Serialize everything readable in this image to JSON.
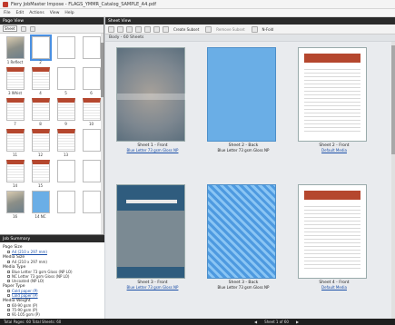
{
  "window": {
    "title": "Fiery JobMaster Impose - FLAGS_YMMR_Catalog_SAMPLE_A4.pdf"
  },
  "menu": [
    "File",
    "Edit",
    "Actions",
    "View",
    "Help"
  ],
  "page_view": {
    "header": "Page View",
    "mode": "Sheet",
    "thumbnails": [
      {
        "label": "1 Reflect",
        "kind": "photo"
      },
      {
        "label": "2",
        "kind": "white",
        "selected": true
      },
      {
        "label": "",
        "kind": "white"
      },
      {
        "label": "",
        "kind": "white"
      },
      {
        "label": "3 Whist",
        "kind": "table"
      },
      {
        "label": "4",
        "kind": "table"
      },
      {
        "label": "5",
        "kind": "white"
      },
      {
        "label": "6",
        "kind": "white"
      },
      {
        "label": "7",
        "kind": "table"
      },
      {
        "label": "8",
        "kind": "table"
      },
      {
        "label": "9",
        "kind": "table"
      },
      {
        "label": "10",
        "kind": "table"
      },
      {
        "label": "11",
        "kind": "table"
      },
      {
        "label": "12",
        "kind": "table"
      },
      {
        "label": "13",
        "kind": "table"
      },
      {
        "label": "",
        "kind": "white"
      },
      {
        "label": "14",
        "kind": "table"
      },
      {
        "label": "15",
        "kind": "table"
      },
      {
        "label": "",
        "kind": "white"
      },
      {
        "label": "",
        "kind": "white"
      },
      {
        "label": "16",
        "kind": "photo"
      },
      {
        "label": "14 NC",
        "kind": "blue"
      },
      {
        "label": "",
        "kind": "white"
      },
      {
        "label": "",
        "kind": "white"
      }
    ]
  },
  "job_summary": {
    "header": "Job Summary",
    "sections": [
      {
        "title": "Page Size",
        "items": [
          {
            "text": "A4 (210 x 297 mm)",
            "link": true
          }
        ]
      },
      {
        "title": "Media Size",
        "items": [
          {
            "text": "A4 (210 x 297 mm)",
            "link": false
          }
        ]
      },
      {
        "title": "Media Type",
        "items": [
          {
            "text": "Blue Letter 73 gsm Gloss (NP LO)",
            "link": false
          },
          {
            "text": "NC Letter 73 gsm Gloss (NP LO)",
            "link": false
          },
          {
            "text": "Uncoated (NP LO)",
            "link": false
          }
        ]
      },
      {
        "title": "Paper Type",
        "items": [
          {
            "text": "Cold paper (P)",
            "link": true
          },
          {
            "text": "Cold paper (P)",
            "link": true
          }
        ]
      },
      {
        "title": "Media Weight",
        "items": [
          {
            "text": "60-90 gsm (P)",
            "link": false
          },
          {
            "text": "75-90 gsm (P)",
            "link": false
          },
          {
            "text": "91-105 gsm (P)",
            "link": false
          }
        ]
      }
    ]
  },
  "sheet_view": {
    "header": "Sheet View",
    "toolbar": {
      "create_subset": "Create Subset",
      "remove_subset": "Remove Subset",
      "n_fold": "N-Fold"
    },
    "group_label": "Body - 60 Sheets",
    "sheets": [
      {
        "caption": "Sheet 1 - Front",
        "media": "Blue Letter 73 gsm Gloss NP",
        "media_link": true,
        "kind": "photo-cover"
      },
      {
        "caption": "Sheet 2 - Back",
        "media": "Blue Letter 73 gsm Gloss NP",
        "media_link": false,
        "kind": "blue"
      },
      {
        "caption": "Sheet 2 - Front",
        "media": "Default Media",
        "media_link": true,
        "kind": "table"
      },
      {
        "caption": "Sheet 3 - Front",
        "media": "Blue Letter 73 gsm Gloss NP",
        "media_link": true,
        "kind": "photo-blue"
      },
      {
        "caption": "Sheet 3 - Back",
        "media": "Blue Letter 73 gsm Gloss NP",
        "media_link": false,
        "kind": "bluepat"
      },
      {
        "caption": "Sheet 4 - Front",
        "media": "Default Media",
        "media_link": true,
        "kind": "table"
      }
    ]
  },
  "status": {
    "left": "Total Pages: 60  Total Sheets: 60",
    "sheet_nav": "Sheet 1 of 60"
  }
}
